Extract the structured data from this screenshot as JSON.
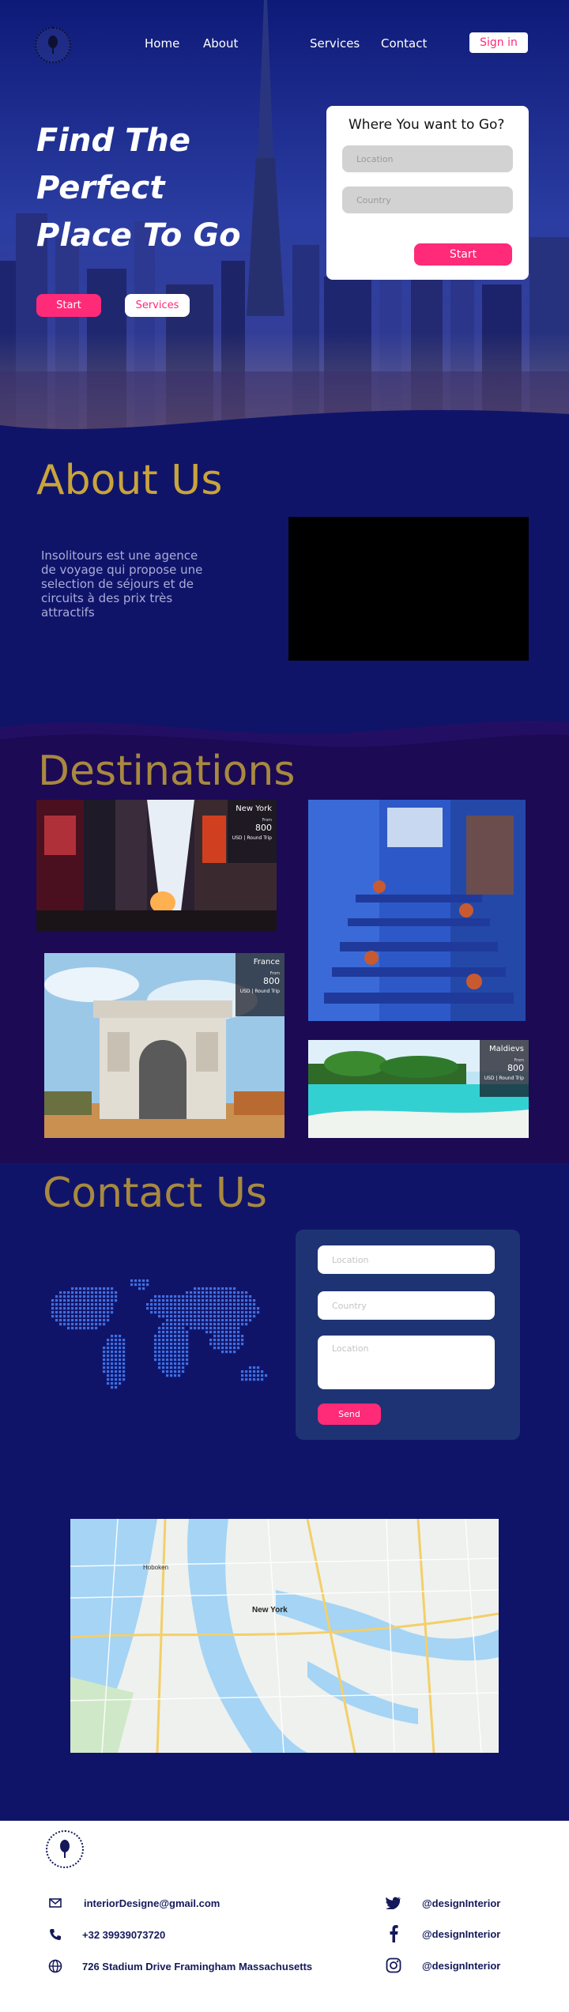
{
  "nav": {
    "links": [
      "Home",
      "About",
      "Services",
      "Contact"
    ],
    "signin_label": "Sign in"
  },
  "hero": {
    "title_lines": [
      "Find The",
      "Perfect",
      "Place To Go"
    ],
    "start_label": "Start",
    "services_label": "Services"
  },
  "search": {
    "title": "Where You want to Go?",
    "location_placeholder": "Location",
    "country_placeholder": "Country",
    "button_label": "Start"
  },
  "about": {
    "title": "About Us",
    "text": "Insolitours est une agence de voyage qui propose une selection de séjours et de circuits à des prix très attractifs"
  },
  "destinations": {
    "title": "Destinations",
    "cards": [
      {
        "city": "New York",
        "from": "From",
        "price": "800",
        "unit": "USD | Round Trip"
      },
      {
        "city": "France",
        "from": "From",
        "price": "800",
        "unit": "USD | Round Trip"
      },
      {
        "city": "Maldievs",
        "from": "From",
        "price": "800",
        "unit": "USD | Round Trip"
      }
    ]
  },
  "contact": {
    "title": "Contact Us",
    "location_placeholder": "Location",
    "country_placeholder": "Country",
    "message_placeholder": "Location",
    "send_label": "Send"
  },
  "map": {
    "city_label": "New York",
    "hoboken_label": "Hoboken"
  },
  "footer": {
    "email": "interiorDesigne@gmail.com",
    "phone": "+32 39939073720",
    "address": "726 Stadium Drive Framingham Massachusetts",
    "twitter": "@designInterior",
    "facebook": "@designInterior",
    "instagram": "@designInterior"
  },
  "colors": {
    "accent_pink": "#ff2a78",
    "section_gold": "#c9a43b",
    "page_navy": "#101469",
    "dest_purple": "#1c0a55"
  },
  "icons": [
    "logo-icon",
    "mail-icon",
    "phone-icon",
    "globe-icon",
    "twitter-icon",
    "facebook-icon",
    "instagram-icon"
  ]
}
